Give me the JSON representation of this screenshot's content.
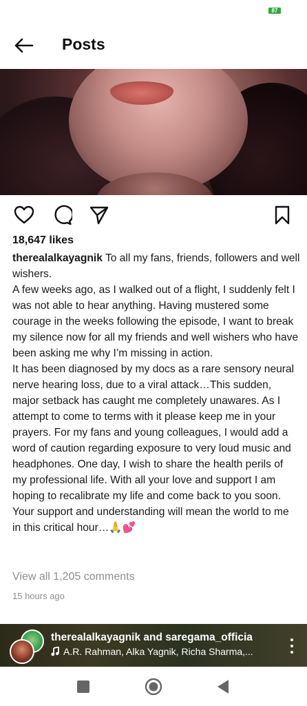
{
  "status_bar": {
    "battery": "87"
  },
  "header": {
    "title": "Posts",
    "back_icon": "arrow-left-icon"
  },
  "post": {
    "likes": "18,647 likes",
    "username": "therealalkayagnik",
    "caption_body": " To all my fans, friends, followers and well wishers.\nA few weeks ago, as I walked out of a flight, I suddenly felt I was not able to hear anything. Having mustered some courage in the weeks following the episode, I want to break my silence now for all my friends and well wishers who have been asking me why I’m missing in action.\nIt has been diagnosed by my docs as a rare sensory neural nerve hearing loss, due to a viral attack…This sudden, major setback has caught me completely unawares. As I attempt to come to terms with it please keep me in your prayers. For my fans and young colleagues, I would add a word of caution regarding exposure to very loud music and headphones. One day, I wish to share the health perils of my professional life.  With all your love and support I am hoping to recalibrate my life and come back to you soon. Your support and understanding will mean the world to me in this critical hour…🙏💕",
    "view_comments": "View all 1,205 comments",
    "time_ago": "15 hours ago"
  },
  "now_playing": {
    "title": "therealalkayagnik and saregama_officia",
    "track": "A.R. Rahman, Alka Yagnik, Richa Sharma,..."
  },
  "colors": {
    "battery": "#2ea83b",
    "muted_text": "#8e8e8e"
  }
}
